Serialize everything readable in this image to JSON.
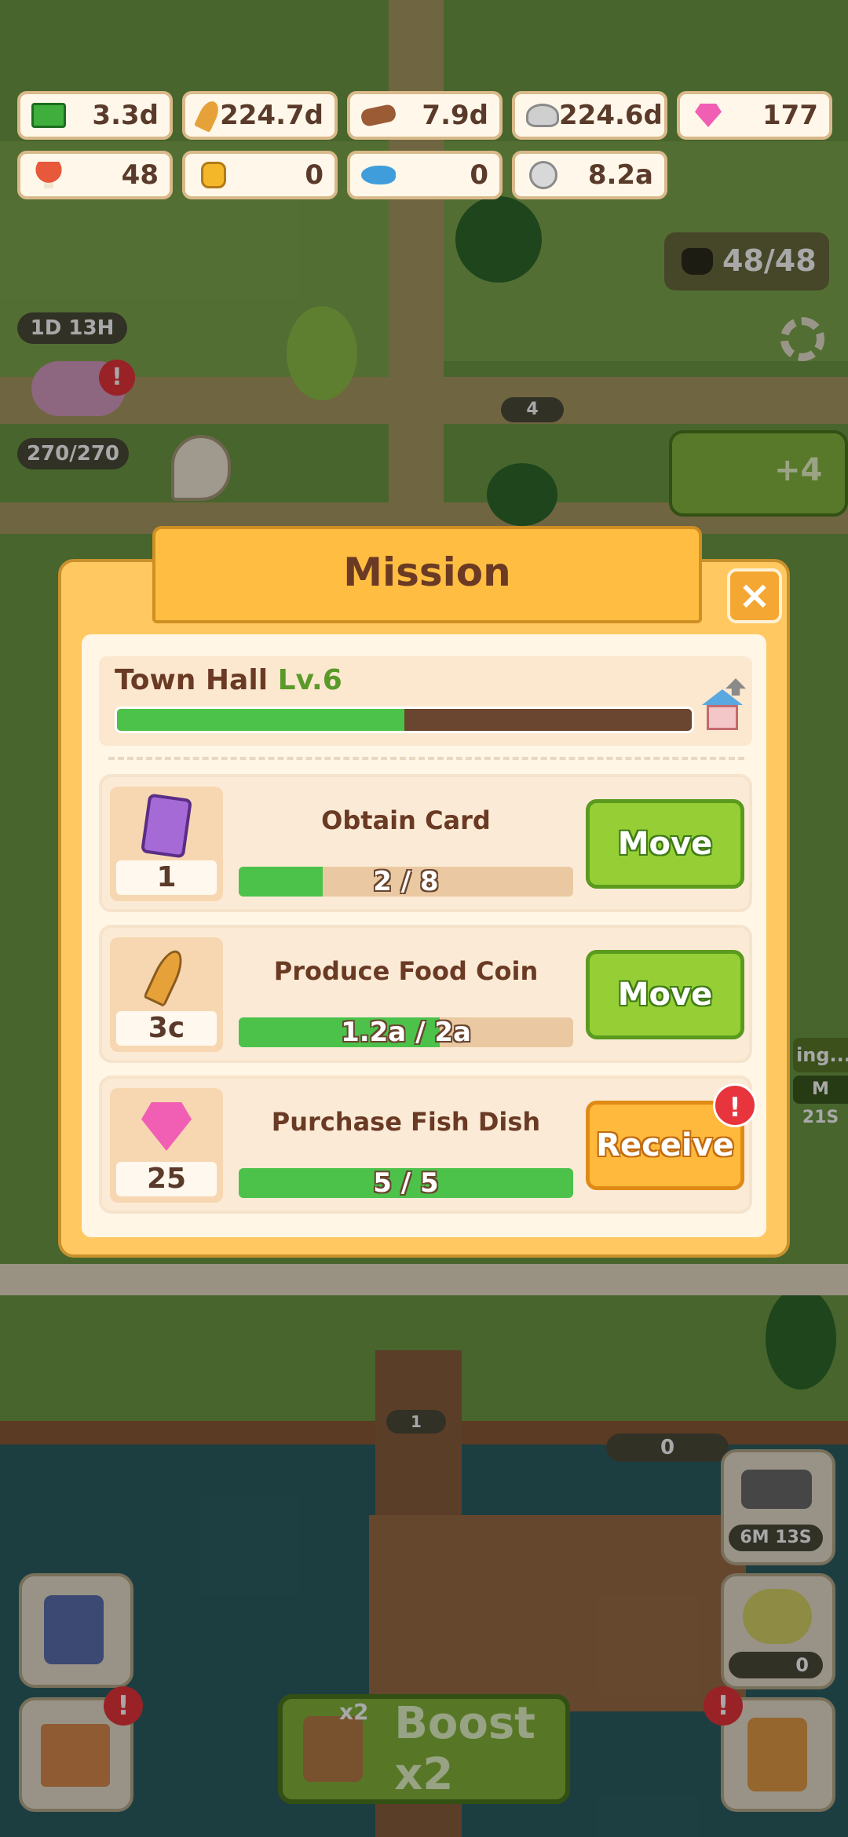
{
  "resources": [
    {
      "icon": "cash-icon",
      "value": "3.3d"
    },
    {
      "icon": "wheat-icon",
      "value": "224.7d"
    },
    {
      "icon": "wood-log-icon",
      "value": "7.9d"
    },
    {
      "icon": "stone-icon",
      "value": "224.6d"
    },
    {
      "icon": "gem-icon",
      "value": "177"
    },
    {
      "icon": "mushroom-icon",
      "value": "48"
    },
    {
      "icon": "honey-jar-icon",
      "value": "0"
    },
    {
      "icon": "fish-icon",
      "value": "0"
    },
    {
      "icon": "paw-coin-icon",
      "value": "8.2a"
    }
  ],
  "hud": {
    "cat_count": "48/48",
    "building_timer": "1D 13H",
    "building_capacity": "270/270",
    "cat_badge": "4",
    "ad_bonus": "+4",
    "fish_counter": "1",
    "boat_counter": "0",
    "timer_right": "M 21S",
    "status_right": "ing...",
    "hammer_timer": "6M 13S",
    "fruit_counter": "0",
    "boost_label": "Boost x2",
    "boost_multiplier": "x2"
  },
  "dialog": {
    "title": "Mission",
    "close_label": "×",
    "town_hall": {
      "name": "Town Hall",
      "level": "Lv.6",
      "progress": 0.5
    },
    "missions": [
      {
        "reward_icon": "card-icon",
        "reward_amount": "1",
        "title": "Obtain Card",
        "progress_text": "2 / 8",
        "progress": 0.25,
        "button": "Move",
        "button_type": "move"
      },
      {
        "reward_icon": "wheat-icon",
        "reward_amount": "3c",
        "title": "Produce Food Coin",
        "progress_text": "1.2a / 2a",
        "progress": 0.6,
        "button": "Move",
        "button_type": "move"
      },
      {
        "reward_icon": "gem-icon",
        "reward_amount": "25",
        "title": "Purchase Fish Dish",
        "progress_text": "5 / 5",
        "progress": 1.0,
        "button": "Receive",
        "button_type": "receive",
        "alert": "!"
      }
    ]
  },
  "alerts": {
    "mark": "!"
  },
  "colors": {
    "progress_green": "#4cc24a",
    "move_green": "#95cf35",
    "receive_orange": "#ffb93c",
    "dialog_orange": "#ffc861"
  }
}
